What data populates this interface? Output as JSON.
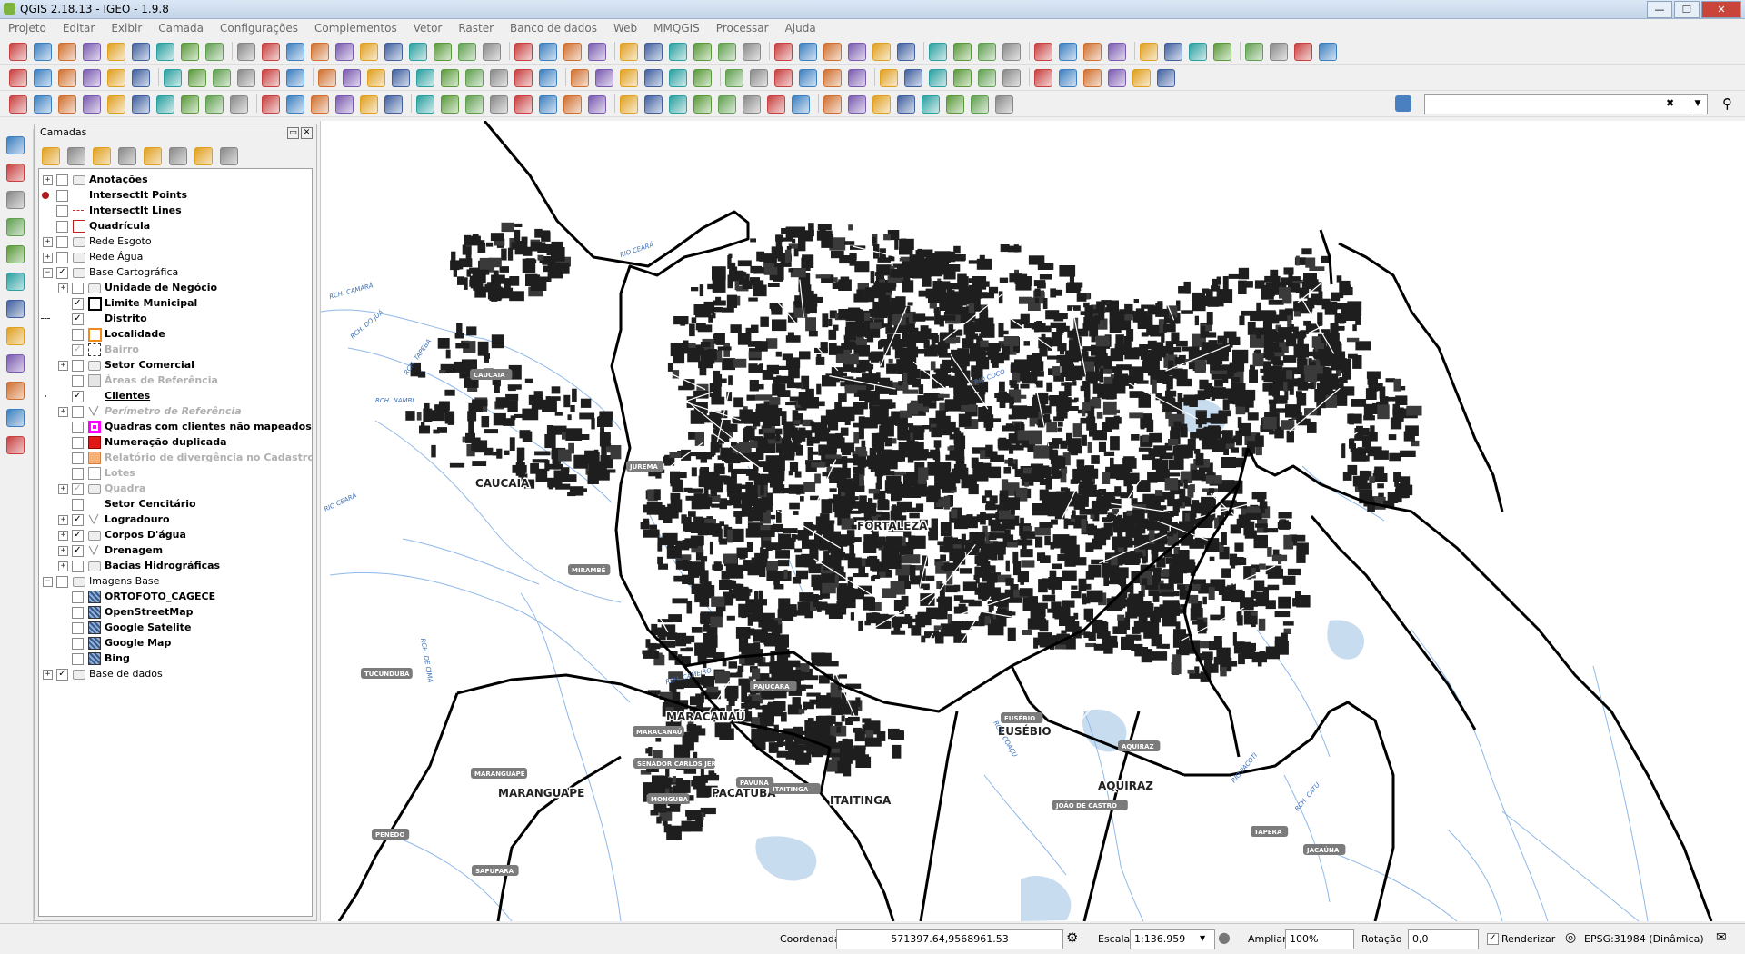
{
  "window": {
    "title": "QGIS 2.18.13 - IGEO - 1.9.8",
    "controls": [
      "0",
      "1",
      "r"
    ]
  },
  "menu": [
    "Projeto",
    "Editar",
    "Exibir",
    "Camada",
    "Configurações",
    "Complementos",
    "Vetor",
    "Raster",
    "Banco de dados",
    "Web",
    "MMQGIS",
    "Processar",
    "Ajuda"
  ],
  "layers_panel": {
    "title": "Camadas",
    "items": [
      {
        "label": "Anotações",
        "expander": "+",
        "checked": false,
        "style": "bold",
        "symbol": "group-icon"
      },
      {
        "label": "IntersectIt Points",
        "expander": "",
        "checked": false,
        "style": "bold",
        "symbol": "red-dot-icon"
      },
      {
        "label": "IntersectIt Lines",
        "expander": "",
        "checked": false,
        "style": "bold",
        "symbol": "red-line-icon"
      },
      {
        "label": "Quadrícula",
        "expander": "",
        "checked": false,
        "style": "bold",
        "symbol": "red-square-icon"
      },
      {
        "label": "Rede Esgoto",
        "expander": "+",
        "checked": false,
        "style": "normal",
        "symbol": "group-icon"
      },
      {
        "label": "Rede Água",
        "expander": "+",
        "checked": false,
        "style": "normal",
        "symbol": "group-icon"
      },
      {
        "label": "Base Cartográfica",
        "expander": "-",
        "checked": true,
        "style": "normal",
        "symbol": "group-icon"
      },
      {
        "label": "Unidade de Negócio",
        "expander": "+",
        "checked": false,
        "style": "bold",
        "symbol": "group-icon",
        "indent": 1
      },
      {
        "label": "Limite Municipal",
        "expander": "",
        "checked": true,
        "style": "bold",
        "symbol": "black-square-icon",
        "indent": 1
      },
      {
        "label": "Distrito",
        "expander": "",
        "checked": true,
        "style": "bold",
        "symbol": "dash-icon",
        "indent": 1
      },
      {
        "label": "Localidade",
        "expander": "",
        "checked": false,
        "style": "bold",
        "symbol": "orange-square-icon",
        "indent": 1
      },
      {
        "label": "Bairro",
        "expander": "",
        "checked": true,
        "style": "grey",
        "symbol": "dashed-square-icon",
        "indent": 1
      },
      {
        "label": "Setor Comercial",
        "expander": "+",
        "checked": false,
        "style": "bold",
        "symbol": "group-icon",
        "indent": 1
      },
      {
        "label": "Áreas de Referência",
        "expander": "",
        "checked": false,
        "style": "grey",
        "symbol": "grey-square-icon",
        "indent": 1
      },
      {
        "label": "Clientes",
        "expander": "",
        "checked": true,
        "style": "bold-underline",
        "symbol": "dot-icon",
        "indent": 1
      },
      {
        "label": "Perímetro de Referência",
        "expander": "+",
        "checked": false,
        "style": "grey-italic",
        "symbol": "line-icon",
        "indent": 1
      },
      {
        "label": "Quadras com clientes não mapeados",
        "expander": "",
        "checked": false,
        "style": "bold",
        "symbol": "magenta-square-icon",
        "indent": 1
      },
      {
        "label": "Numeração duplicada",
        "expander": "",
        "checked": false,
        "style": "bold",
        "symbol": "red-fill-icon",
        "indent": 1
      },
      {
        "label": "Relatório de divergência no Cadastro",
        "expander": "",
        "checked": false,
        "style": "grey",
        "symbol": "peach-square-icon",
        "indent": 1
      },
      {
        "label": "Lotes",
        "expander": "",
        "checked": false,
        "style": "grey",
        "symbol": "white-square-icon",
        "indent": 1
      },
      {
        "label": "Quadra",
        "expander": "+",
        "checked": true,
        "style": "grey",
        "symbol": "group-icon",
        "indent": 1
      },
      {
        "label": "Setor Cencitário",
        "expander": "",
        "checked": false,
        "style": "bold",
        "symbol": "none",
        "indent": 1
      },
      {
        "label": "Logradouro",
        "expander": "+",
        "checked": true,
        "style": "bold",
        "symbol": "line-icon",
        "indent": 1
      },
      {
        "label": "Corpos D'água",
        "expander": "+",
        "checked": true,
        "style": "bold",
        "symbol": "group-icon",
        "indent": 1
      },
      {
        "label": "Drenagem",
        "expander": "+",
        "checked": true,
        "style": "bold",
        "symbol": "line-icon",
        "indent": 1
      },
      {
        "label": "Bacias Hidrográficas",
        "expander": "+",
        "checked": false,
        "style": "bold",
        "symbol": "group-icon",
        "indent": 1
      },
      {
        "label": "Imagens Base",
        "expander": "-",
        "checked": false,
        "style": "normal",
        "symbol": "group-icon"
      },
      {
        "label": "ORTOFOTO_CAGECE",
        "expander": "",
        "checked": false,
        "style": "bold",
        "symbol": "raster-icon",
        "indent": 1
      },
      {
        "label": "OpenStreetMap",
        "expander": "",
        "checked": false,
        "style": "bold",
        "symbol": "raster-icon",
        "indent": 1
      },
      {
        "label": "Google Satelite",
        "expander": "",
        "checked": false,
        "style": "bold",
        "symbol": "raster-icon",
        "indent": 1
      },
      {
        "label": "Google Map",
        "expander": "",
        "checked": false,
        "style": "bold",
        "symbol": "raster-icon",
        "indent": 1
      },
      {
        "label": "Bing",
        "expander": "",
        "checked": false,
        "style": "bold",
        "symbol": "raster-icon",
        "indent": 1
      },
      {
        "label": "Base de dados",
        "expander": "+",
        "checked": true,
        "style": "normal",
        "symbol": "group-icon"
      }
    ]
  },
  "map": {
    "municipalities": [
      "CAUCAIA",
      "FORTALEZA",
      "MARACANAÚ",
      "EUSÉBIO",
      "MARANGUAPE",
      "PACATUBA",
      "ITAITINGA",
      "AQUIRAZ"
    ],
    "localities": [
      "CAUCAIA",
      "JUREMA",
      "MIRAMBÉ",
      "TUCUNDUBA",
      "PAJUÇARA",
      "MARACANAÚ",
      "SENADOR CARLOS JERESSATI",
      "MARANGUAPE",
      "MONGUBA",
      "PAVUNA",
      "ITAITINGA",
      "EUSÉBIO",
      "AQUIRAZ",
      "JOÃO DE CASTRO",
      "TAPERA",
      "JACAÚNA",
      "PENEDO",
      "SAPUPARA"
    ],
    "rivers": [
      "RIO CEARÁ",
      "RCH. CAMARÁ",
      "RCH. DO JUÁ",
      "RCH. TAPEBA",
      "RCH. NAMBI",
      "RIO CEARÁ",
      "RCH. DE CIMA",
      "RIO COCÓ",
      "RCH. CAMEIRO",
      "RCH. COAÇU",
      "RIO PACOTI",
      "RCH. CATU"
    ]
  },
  "status": {
    "coordinate_label": "Coordenada",
    "coordinate_value": "571397.64,9568961.53",
    "scale_label": "Escala",
    "scale_value": "1:136.959",
    "zoom_label": "Ampliar",
    "zoom_value": "100%",
    "rotation_label": "Rotação",
    "rotation_value": "0,0",
    "render_label": "Renderizar",
    "crs_label": "EPSG:31984 (Dinâmica)"
  }
}
